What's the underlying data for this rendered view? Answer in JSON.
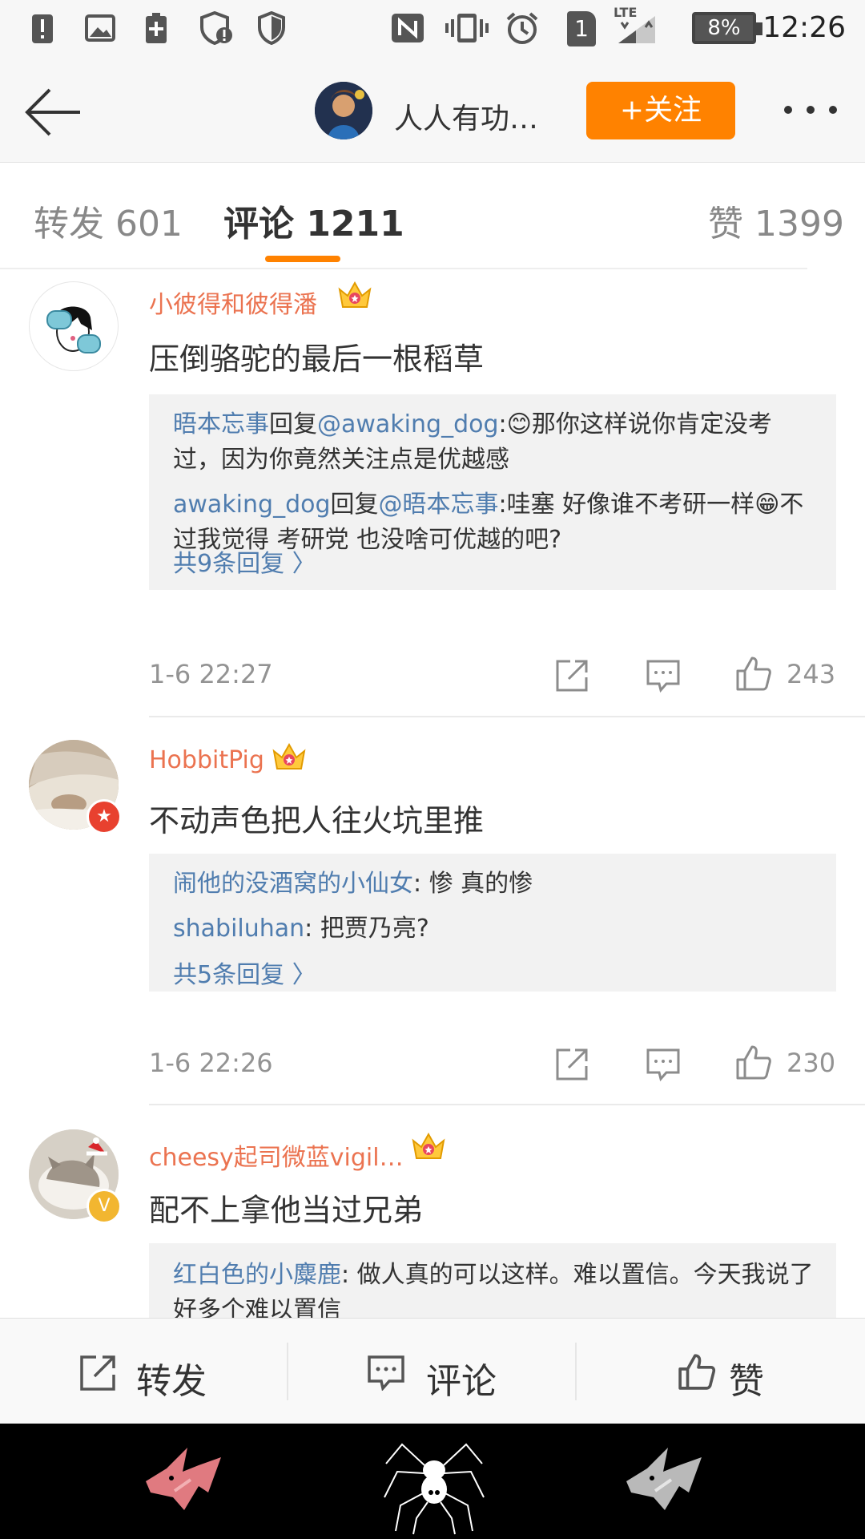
{
  "status_bar": {
    "time": "12:26",
    "battery": "8%",
    "sim_slot": "1",
    "network": "LTE",
    "icons": [
      "alert-icon",
      "image-icon",
      "battery-saver-icon",
      "shield-alert-icon",
      "shield-icon",
      "nfc-icon",
      "vibrate-icon",
      "alarm-icon",
      "sim-icon",
      "signal-icon",
      "battery-icon"
    ]
  },
  "header": {
    "title": "人人有功…",
    "follow_label": "+关注",
    "icons": [
      "back-arrow-icon",
      "more-dots-icon"
    ]
  },
  "tabs": [
    {
      "label": "转发 601"
    },
    {
      "label": "评论 1211"
    },
    {
      "label": "赞 1399"
    }
  ],
  "comments": [
    {
      "username": "小彼得和彼得潘",
      "text": "压倒骆驼的最后一根稻草",
      "replies": [
        {
          "user": "晤本忘事",
          "mid": "回复",
          "target": "@awaking_dog",
          "text": ":😊那你这样说你肯定没考过，因为你竟然关注点是优越感"
        },
        {
          "user": "awaking_dog",
          "mid": "回复",
          "target": "@晤本忘事",
          "text": ":哇塞 好像谁不考研一样😁不过我觉得 考研党 也没啥可优越的吧?"
        }
      ],
      "more_replies": "共9条回复 〉",
      "time": "1-6 22:27",
      "likes": "243"
    },
    {
      "username": "HobbitPig",
      "text": "不动声色把人往火坑里推",
      "replies": [
        {
          "user": "闹他的没酒窝的小仙女",
          "text": ": 惨  真的惨"
        },
        {
          "user": "shabiluhan",
          "text": ": 把贾乃亮?"
        }
      ],
      "more_replies": "共5条回复 〉",
      "time": "1-6 22:26",
      "likes": "230"
    },
    {
      "username": "cheesy起司微蓝vigil…",
      "text": "配不上拿他当过兄弟",
      "replies": [
        {
          "user": "红白色的小麋鹿",
          "text": ": 做人真的可以这样。难以置信。今天我说了好多个难以置信"
        }
      ]
    }
  ],
  "bottom_bar": {
    "repost": "转发",
    "comment": "评论",
    "like": "赞"
  },
  "colors": {
    "accent": "#ff8200",
    "username": "#eb7350",
    "link": "#507daf",
    "meta": "#939393"
  }
}
